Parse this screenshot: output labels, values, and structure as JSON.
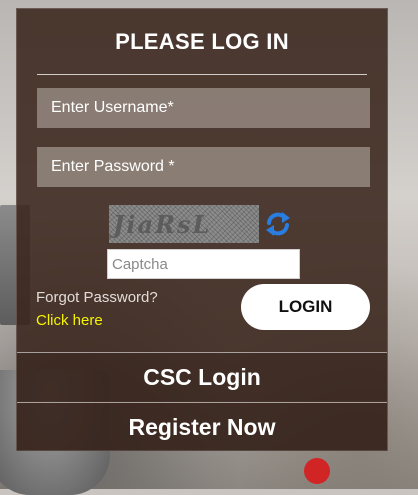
{
  "login_panel": {
    "title": "PLEASE LOG IN",
    "username_placeholder": "Enter Username*",
    "password_placeholder": "Enter Password *",
    "captcha_image_text": "JiaRsL",
    "captcha_placeholder": "Captcha",
    "forgot_password_text": "Forgot Password?",
    "click_here_link": "Click here",
    "login_button": "LOGIN",
    "csc_login": "CSC Login",
    "register_now": "Register Now"
  },
  "colors": {
    "panel_bg": "#3a261c",
    "link_yellow": "#f4f400",
    "refresh_blue": "#2a7de1",
    "button_bg": "#ffffff"
  },
  "icons": {
    "refresh": "refresh-icon"
  }
}
